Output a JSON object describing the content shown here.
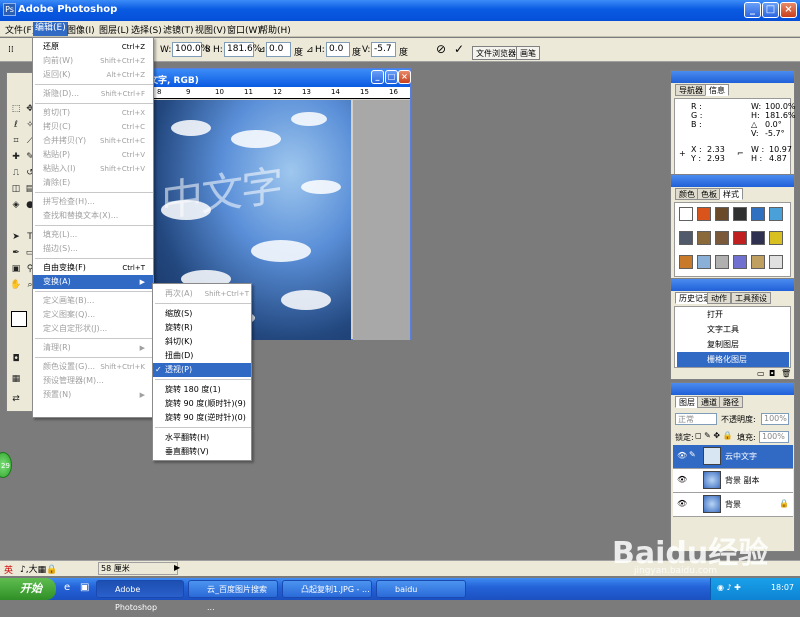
{
  "window": {
    "title": "Adobe Photoshop"
  },
  "menubar": [
    "文件(F)",
    "编辑(E)",
    "图像(I)",
    "图层(L)",
    "选择(S)",
    "滤镜(T)",
    "视图(V)",
    "窗口(W)",
    "帮助(H)"
  ],
  "options": {
    "w_label": "W:",
    "w_value": "100.0%",
    "h_label": "H:",
    "h_value": "181.6%",
    "angle_value": "0.0",
    "angle_unit": "度",
    "skew_h_label": "H:",
    "skew_h_value": "0.0",
    "skew_h_unit": "度",
    "skew_v_label": "V:",
    "skew_v_value": "-5.7",
    "skew_v_unit": "度",
    "tab_browser": "文件浏览器",
    "tab_brush": "画笔"
  },
  "document": {
    "title_partial": "文字, RGB)",
    "ruler_ticks": [
      "8",
      "9",
      "10",
      "11",
      "12",
      "13",
      "14",
      "15",
      "16"
    ],
    "canvas_text": "中文字"
  },
  "edit_menu": [
    {
      "label": "还原",
      "sc": "Ctrl+Z",
      "dis": false
    },
    {
      "label": "向前(W)",
      "sc": "Shift+Ctrl+Z",
      "dis": true
    },
    {
      "label": "返回(K)",
      "sc": "Alt+Ctrl+Z",
      "dis": true
    },
    {
      "label": "渐隐(D)...",
      "sc": "Shift+Ctrl+F",
      "dis": true
    },
    {
      "label": "剪切(T)",
      "sc": "Ctrl+X",
      "dis": true
    },
    {
      "label": "拷贝(C)",
      "sc": "Ctrl+C",
      "dis": true
    },
    {
      "label": "合并拷贝(Y)",
      "sc": "Shift+Ctrl+C",
      "dis": true
    },
    {
      "label": "粘贴(P)",
      "sc": "Ctrl+V",
      "dis": true
    },
    {
      "label": "粘贴入(I)",
      "sc": "Shift+Ctrl+V",
      "dis": true
    },
    {
      "label": "清除(E)",
      "sc": "",
      "dis": true
    },
    {
      "label": "拼写检查(H)...",
      "sc": "",
      "dis": true
    },
    {
      "label": "查找和替换文本(X)...",
      "sc": "",
      "dis": true
    },
    {
      "label": "填充(L)...",
      "sc": "",
      "dis": true
    },
    {
      "label": "描边(S)...",
      "sc": "",
      "dis": true
    },
    {
      "label": "自由变换(F)",
      "sc": "Ctrl+T",
      "dis": false
    },
    {
      "label": "变换(A)",
      "sc": "▶",
      "dis": false
    },
    {
      "label": "定义画笔(B)...",
      "sc": "",
      "dis": true
    },
    {
      "label": "定义图案(Q)...",
      "sc": "",
      "dis": true
    },
    {
      "label": "定义自定形状(J)...",
      "sc": "",
      "dis": true
    },
    {
      "label": "清理(R)",
      "sc": "▶",
      "dis": true
    },
    {
      "label": "颜色设置(G)...",
      "sc": "Shift+Ctrl+K",
      "dis": true
    },
    {
      "label": "预设管理器(M)...",
      "sc": "",
      "dis": true
    },
    {
      "label": "预置(N)",
      "sc": "▶",
      "dis": true
    }
  ],
  "transform_menu": [
    {
      "label": "再次(A)",
      "sc": "Shift+Ctrl+T",
      "dis": true
    },
    {
      "label": "缩放(S)",
      "sc": ""
    },
    {
      "label": "旋转(R)",
      "sc": ""
    },
    {
      "label": "斜切(K)",
      "sc": ""
    },
    {
      "label": "扭曲(D)",
      "sc": ""
    },
    {
      "label": "透视(P)",
      "sc": "",
      "checked": true
    },
    {
      "label": "旋转 180 度(1)",
      "sc": ""
    },
    {
      "label": "旋转 90 度(顺时针)(9)",
      "sc": ""
    },
    {
      "label": "旋转 90 度(逆时针)(0)",
      "sc": ""
    },
    {
      "label": "水平翻转(H)",
      "sc": ""
    },
    {
      "label": "垂直翻转(V)",
      "sc": ""
    }
  ],
  "navigator": {
    "tabs": [
      "导航器",
      "信息"
    ],
    "r": "R :",
    "g": "G :",
    "b": "B :",
    "w": "W:",
    "w_val": "100.0%",
    "h": "H:",
    "h_val": "181.6%",
    "angle": "△",
    "angle_val": "0.0°",
    "v": "V:",
    "v_val": "-5.7°",
    "x": "X :",
    "x_val": "2.33",
    "y": "Y :",
    "y_val": "2.93",
    "w2": "W :",
    "w2_val": "10.97",
    "h2": "H :",
    "h2_val": "4.87"
  },
  "swatches_tabs": [
    "颜色",
    "色板",
    "样式"
  ],
  "history": {
    "tabs": [
      "历史记录",
      "动作",
      "工具预设"
    ],
    "items": [
      "打开",
      "文字工具",
      "复制图层",
      "栅格化图层"
    ]
  },
  "layers": {
    "tabs": [
      "图层",
      "通道",
      "路径"
    ],
    "mode": "正常",
    "opacity_label": "不透明度:",
    "opacity": "100%",
    "lock_label": "锁定:",
    "fill_label": "填充:",
    "fill": "100%",
    "rows": [
      "云中文字",
      "背景 副本",
      "背景"
    ]
  },
  "status": {
    "ime": "英",
    "zoom": "58 厘米"
  },
  "taskbar": {
    "start": "开始",
    "items": [
      "Adobe Photoshop",
      "云_百度图片搜索 ...",
      "凸起复制1.JPG - ...",
      "baidu"
    ],
    "clock": "18:07"
  },
  "watermark": {
    "main": "Baidu经验",
    "sub": "jingyan.baidu.com"
  },
  "badge": "29"
}
